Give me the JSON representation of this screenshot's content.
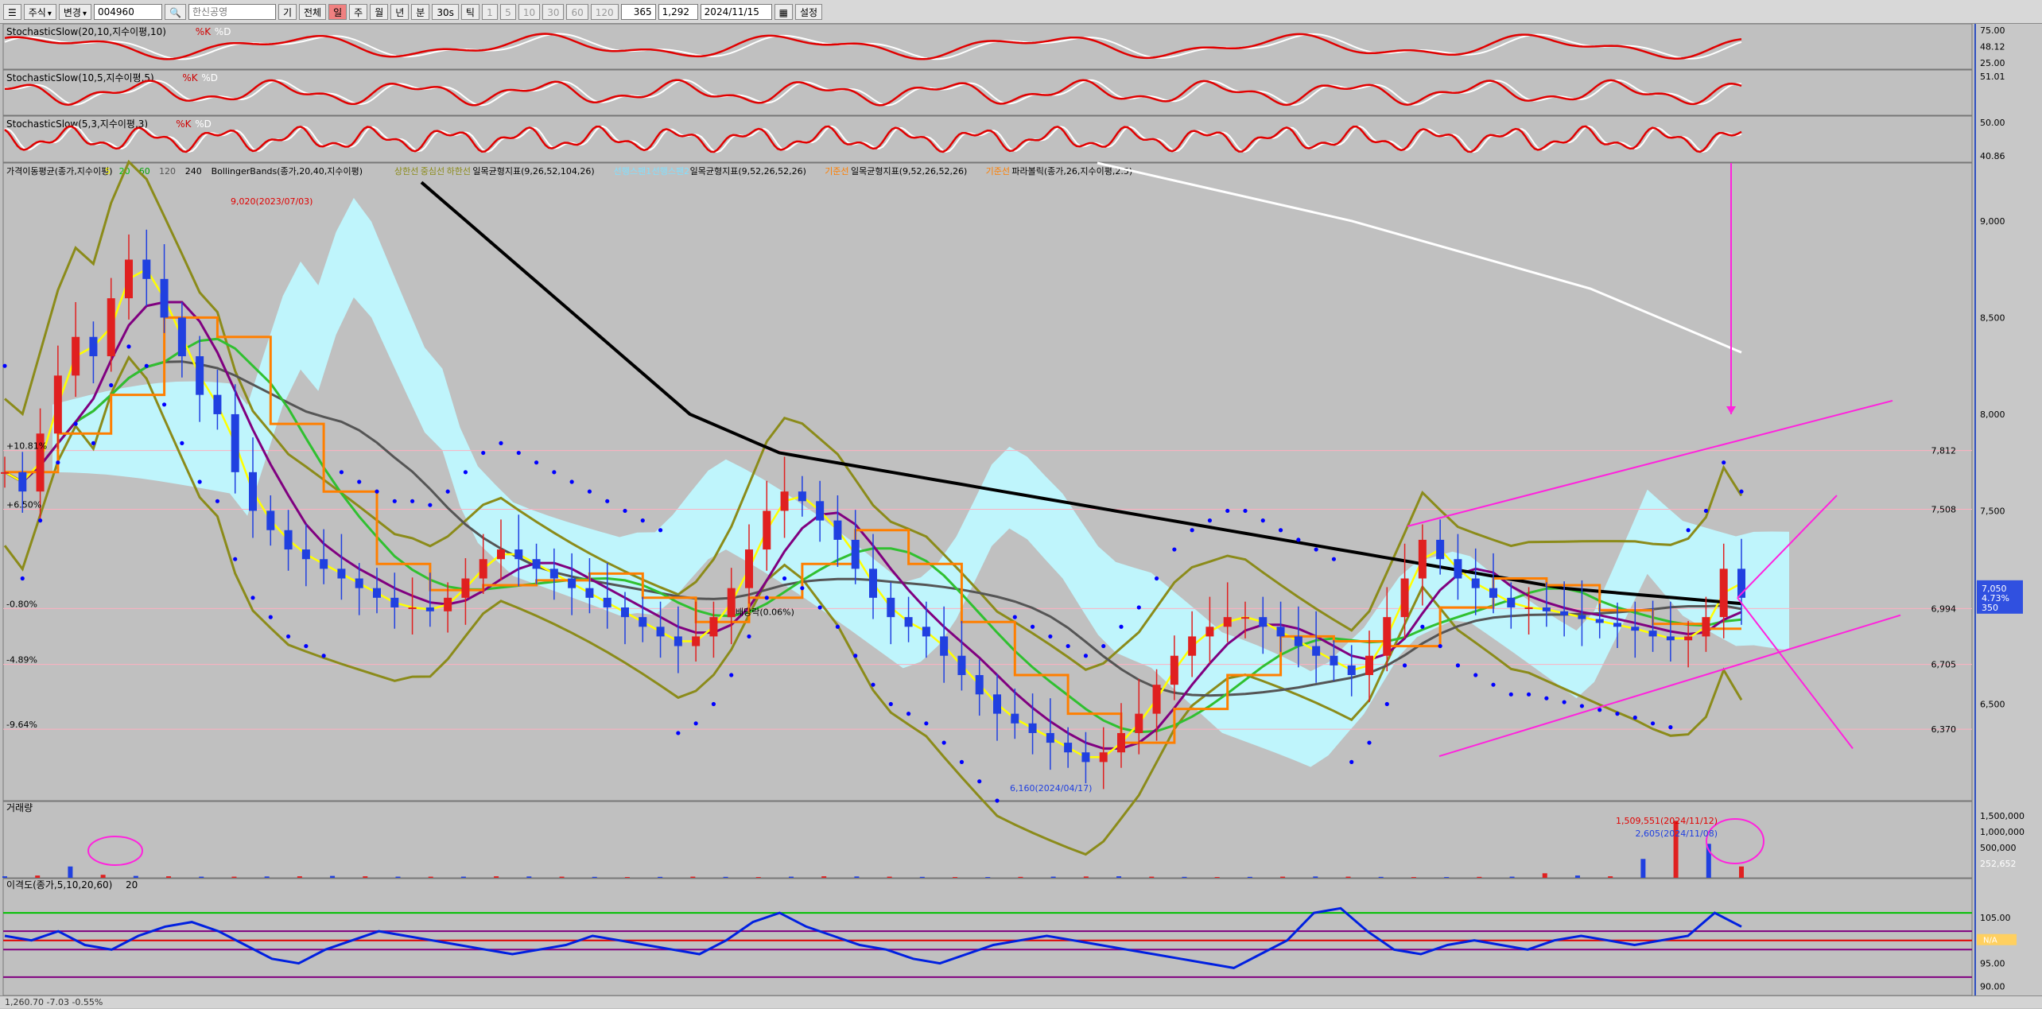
{
  "toolbar": {
    "market": "주식",
    "mode": "변경",
    "code": "004960",
    "name": "한신공영",
    "buttons": [
      "기",
      "전체",
      "일",
      "주",
      "월",
      "년",
      "분",
      "30s",
      "틱"
    ],
    "active_button": "일",
    "minute_options": [
      "1",
      "5",
      "10",
      "30",
      "60",
      "120"
    ],
    "count": "365",
    "ratio": "1,292",
    "date": "2024/11/15",
    "settings": "설정"
  },
  "panels": {
    "stoch1": {
      "title": "StochasticSlow(20,10,지수이평,10)",
      "k": "%K",
      "d": "%D",
      "right_labels": [
        "75.00",
        "48.12",
        "25.00"
      ]
    },
    "stoch2": {
      "title": "StochasticSlow(10,5,지수이평,5)",
      "k": "%K",
      "d": "%D",
      "right_labels": [
        "51.01"
      ]
    },
    "stoch3": {
      "title": "StochasticSlow(5,3,지수이평,3)",
      "k": "%K",
      "d": "%D",
      "right_labels": [
        "50.00",
        "40.86"
      ]
    },
    "price": {
      "legend": [
        "가격이동평균(종가,지수이평)",
        "5",
        "20",
        "60",
        "120",
        "240",
        "BollingerBands(종가,20,40,지수이평)",
        "상한선",
        "중심선",
        "하한선",
        "일목균형지표(9,26,52,104,26)",
        "선행스팬1",
        "선행스팬2",
        "일목균형지표(9,52,26,52,26)",
        "기준선",
        "일목균형지표(9,52,26,52,26)",
        "기준선",
        "파라볼릭(종가,26,지수이평,2.5)"
      ],
      "right_labels": [
        "9,000",
        "8,500",
        "8,000",
        "7,812",
        "7,508",
        "7,500",
        "7,050",
        "6,994",
        "6,705",
        "6,500",
        "6,370"
      ],
      "current_price": "7,050",
      "current_change": "4.73%",
      "current_diff": "350",
      "left_labels": [
        "+10.81%",
        "+6.50%",
        "-0.80%",
        "-4.89%",
        "-9.64%"
      ],
      "annotations": {
        "high": "9,020(2023/07/03)",
        "low": "6,160(2024/04/17)",
        "dividend": "배당락(0.06%)"
      }
    },
    "volume": {
      "title": "거래량",
      "right_labels": [
        "1,500,000",
        "1,000,000",
        "500,000",
        "252,652"
      ],
      "annotations": {
        "peak": "1,509,551(2024/11/12)",
        "small": "2,605(2024/11/08)"
      }
    },
    "disparity": {
      "title": "이격도(종가,5,10,20,60)",
      "param": "20",
      "right_labels": [
        "105.00",
        "100.00",
        "95.00",
        "90.00"
      ],
      "na": "N/A"
    }
  },
  "status": {
    "text": "1,260.70   -7.03   -0.55%"
  },
  "colors": {
    "up": "#e02020",
    "down": "#2040e0",
    "bg": "#c0c0c0",
    "cloud": "#bff8ff",
    "ma240": "#000000",
    "ma120": "#555555",
    "sar": "#0000ff",
    "trend": "#ff22dd",
    "bb": "#8b8b1a",
    "kijun": "#ff7f00"
  },
  "chart_data": {
    "type": "candlestick",
    "title": "한신공영 004960",
    "ylim": [
      6000,
      9300
    ],
    "x": "daily 2023-07 to 2024-11-15",
    "close_series": [
      7700,
      7600,
      7900,
      8200,
      8400,
      8300,
      8600,
      8800,
      8700,
      8500,
      8300,
      8100,
      8000,
      7700,
      7500,
      7400,
      7300,
      7250,
      7200,
      7150,
      7100,
      7050,
      7000,
      7000,
      6980,
      7050,
      7150,
      7250,
      7300,
      7250,
      7200,
      7150,
      7100,
      7050,
      7000,
      6950,
      6900,
      6850,
      6800,
      6850,
      6950,
      7100,
      7300,
      7500,
      7600,
      7550,
      7450,
      7350,
      7200,
      7050,
      6950,
      6900,
      6850,
      6750,
      6650,
      6550,
      6450,
      6400,
      6350,
      6300,
      6250,
      6200,
      6250,
      6350,
      6450,
      6600,
      6750,
      6850,
      6900,
      6950,
      6950,
      6900,
      6850,
      6800,
      6750,
      6700,
      6650,
      6750,
      6950,
      7150,
      7350,
      7250,
      7150,
      7100,
      7050,
      7000,
      7000,
      6980,
      6960,
      6940,
      6920,
      6900,
      6880,
      6850,
      6830,
      6850,
      6950,
      7200,
      7050
    ],
    "ma240_series": [
      9200,
      9100,
      9000,
      8900,
      8800,
      8700,
      8600,
      8500,
      8400,
      8300,
      8200,
      8100,
      8000,
      7950,
      7900,
      7850,
      7800,
      7780,
      7760,
      7740,
      7720,
      7700,
      7680,
      7660,
      7640,
      7620,
      7600,
      7580,
      7560,
      7540,
      7520,
      7500,
      7480,
      7460,
      7440,
      7420,
      7400,
      7380,
      7360,
      7340,
      7320,
      7300,
      7280,
      7260,
      7240,
      7220,
      7200,
      7180,
      7160,
      7140,
      7120,
      7100,
      7090,
      7080,
      7070,
      7060,
      7050,
      7040,
      7030,
      7020
    ],
    "volume_series": [
      40,
      60,
      300,
      80,
      50,
      40,
      30,
      30,
      35,
      40,
      50,
      40,
      30,
      30,
      30,
      40,
      35,
      30,
      25,
      20,
      25,
      30,
      25,
      20,
      30,
      40,
      35,
      30,
      25,
      20,
      20,
      25,
      30,
      35,
      40,
      30,
      25,
      20,
      25,
      30,
      35,
      30,
      25,
      20,
      20,
      25,
      30,
      120,
      60,
      40,
      500,
      1509,
      900,
      300
    ],
    "disparity_series": [
      101,
      100,
      102,
      99,
      98,
      101,
      103,
      104,
      102,
      99,
      96,
      95,
      98,
      100,
      102,
      101,
      100,
      99,
      98,
      97,
      98,
      99,
      101,
      100,
      99,
      98,
      97,
      100,
      104,
      106,
      103,
      101,
      99,
      98,
      96,
      95,
      97,
      99,
      100,
      101,
      100,
      99,
      98,
      97,
      96,
      95,
      94,
      97,
      100,
      106,
      107,
      102,
      98,
      97,
      99,
      100,
      99,
      98,
      100,
      101,
      100,
      99,
      100,
      101,
      106,
      103
    ]
  }
}
